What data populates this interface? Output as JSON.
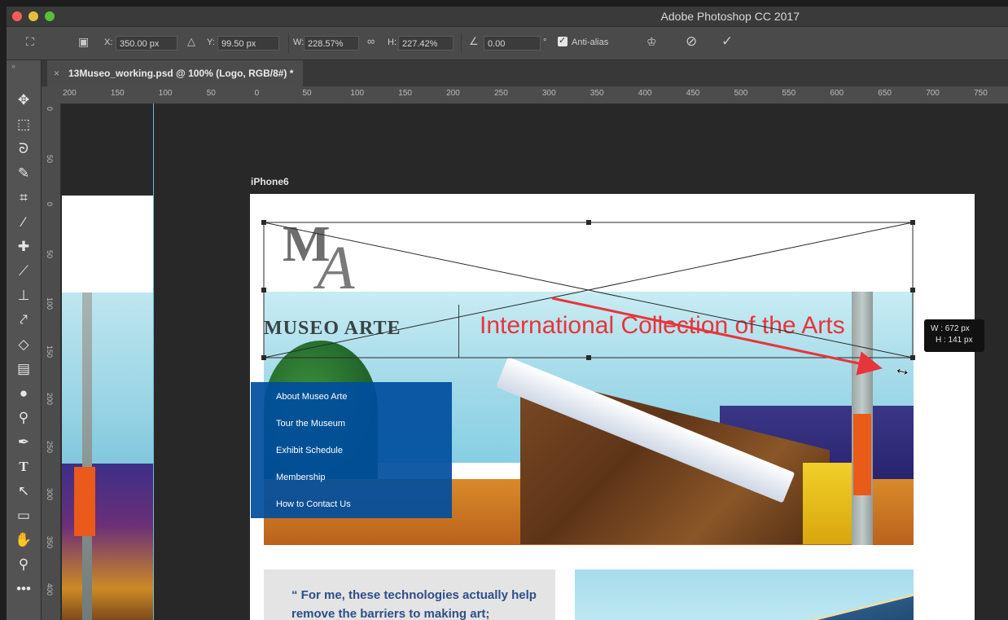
{
  "window": {
    "title": "Adobe Photoshop CC 2017"
  },
  "options_bar": {
    "x_label": "X:",
    "x_value": "350.00 px",
    "y_label": "Y:",
    "y_value": "99.50 px",
    "w_label": "W:",
    "w_value": "228.57%",
    "h_label": "H:",
    "h_value": "227.42%",
    "angle_value": "0.00",
    "degree_symbol": "°",
    "anti_alias_label": "Anti-alias",
    "anti_alias_checked": true
  },
  "document_tab": {
    "label": "13Museo_working.psd @ 100% (Logo, RGB/8#) *",
    "close": "×"
  },
  "ruler": {
    "top": [
      "200",
      "150",
      "100",
      "50",
      "0",
      "50",
      "100",
      "150",
      "200",
      "250",
      "300",
      "350",
      "400",
      "450",
      "500",
      "550",
      "600",
      "650",
      "700",
      "750"
    ],
    "left": [
      "0",
      "50",
      "0",
      "50",
      "100",
      "150",
      "200",
      "250",
      "300",
      "350",
      "400"
    ]
  },
  "artboard": {
    "label": "iPhone6",
    "brand_name": "MUSEO ARTE",
    "tagline": "International Collection of the Arts",
    "logo_letters": {
      "m": "M",
      "a": "A"
    },
    "nav": [
      "About Museo Arte",
      "Tour the Museum",
      "Exhibit Schedule",
      "Membership",
      "How to Contact Us"
    ],
    "quote": "“ For me, these technologies actually help remove the barriers to making art;"
  },
  "transform_tooltip": {
    "w": "W : 672 px",
    "h": "H : 141 px"
  },
  "colors": {
    "accent_red": "#e8343b",
    "nav_blue": "#004d9e",
    "quote_blue": "#2d4f8a"
  }
}
